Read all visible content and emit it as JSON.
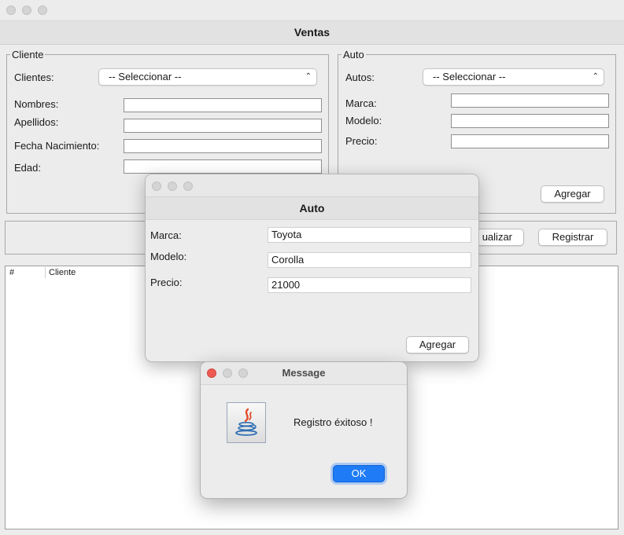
{
  "window": {
    "title": "Ventas"
  },
  "cliente_group": {
    "legend": "Cliente",
    "clientes_label": "Clientes:",
    "clientes_select": "-- Seleccionar --",
    "nombres_label": "Nombres:",
    "apellidos_label": "Apellidos:",
    "fecha_label": "Fecha Nacimiento:",
    "edad_label": "Edad:",
    "nombres_value": "",
    "apellidos_value": "",
    "fecha_value": "",
    "edad_value": ""
  },
  "auto_group": {
    "legend": "Auto",
    "autos_label": "Autos:",
    "autos_select": "-- Seleccionar --",
    "marca_label": "Marca:",
    "modelo_label": "Modelo:",
    "precio_label": "Precio:",
    "agregar_label": "Agregar"
  },
  "actions": {
    "actualizar_label": "ualizar",
    "registrar_label": "Registrar"
  },
  "table": {
    "columns": [
      "#",
      "Cliente"
    ]
  },
  "auto_dialog": {
    "title": "Auto",
    "marca_label": "Marca:",
    "modelo_label": "Modelo:",
    "precio_label": "Precio:",
    "marca_value": "Toyota",
    "modelo_value": "Corolla",
    "precio_value": "21000",
    "agregar_label": "Agregar"
  },
  "message_dialog": {
    "title": "Message",
    "text": "Registro éxitoso !",
    "ok_label": "OK",
    "icon": "java-icon"
  },
  "colors": {
    "ok_button": "#1f7cf6",
    "close_light": "#ee5a52",
    "inactive_light": "#d4d4d4"
  }
}
